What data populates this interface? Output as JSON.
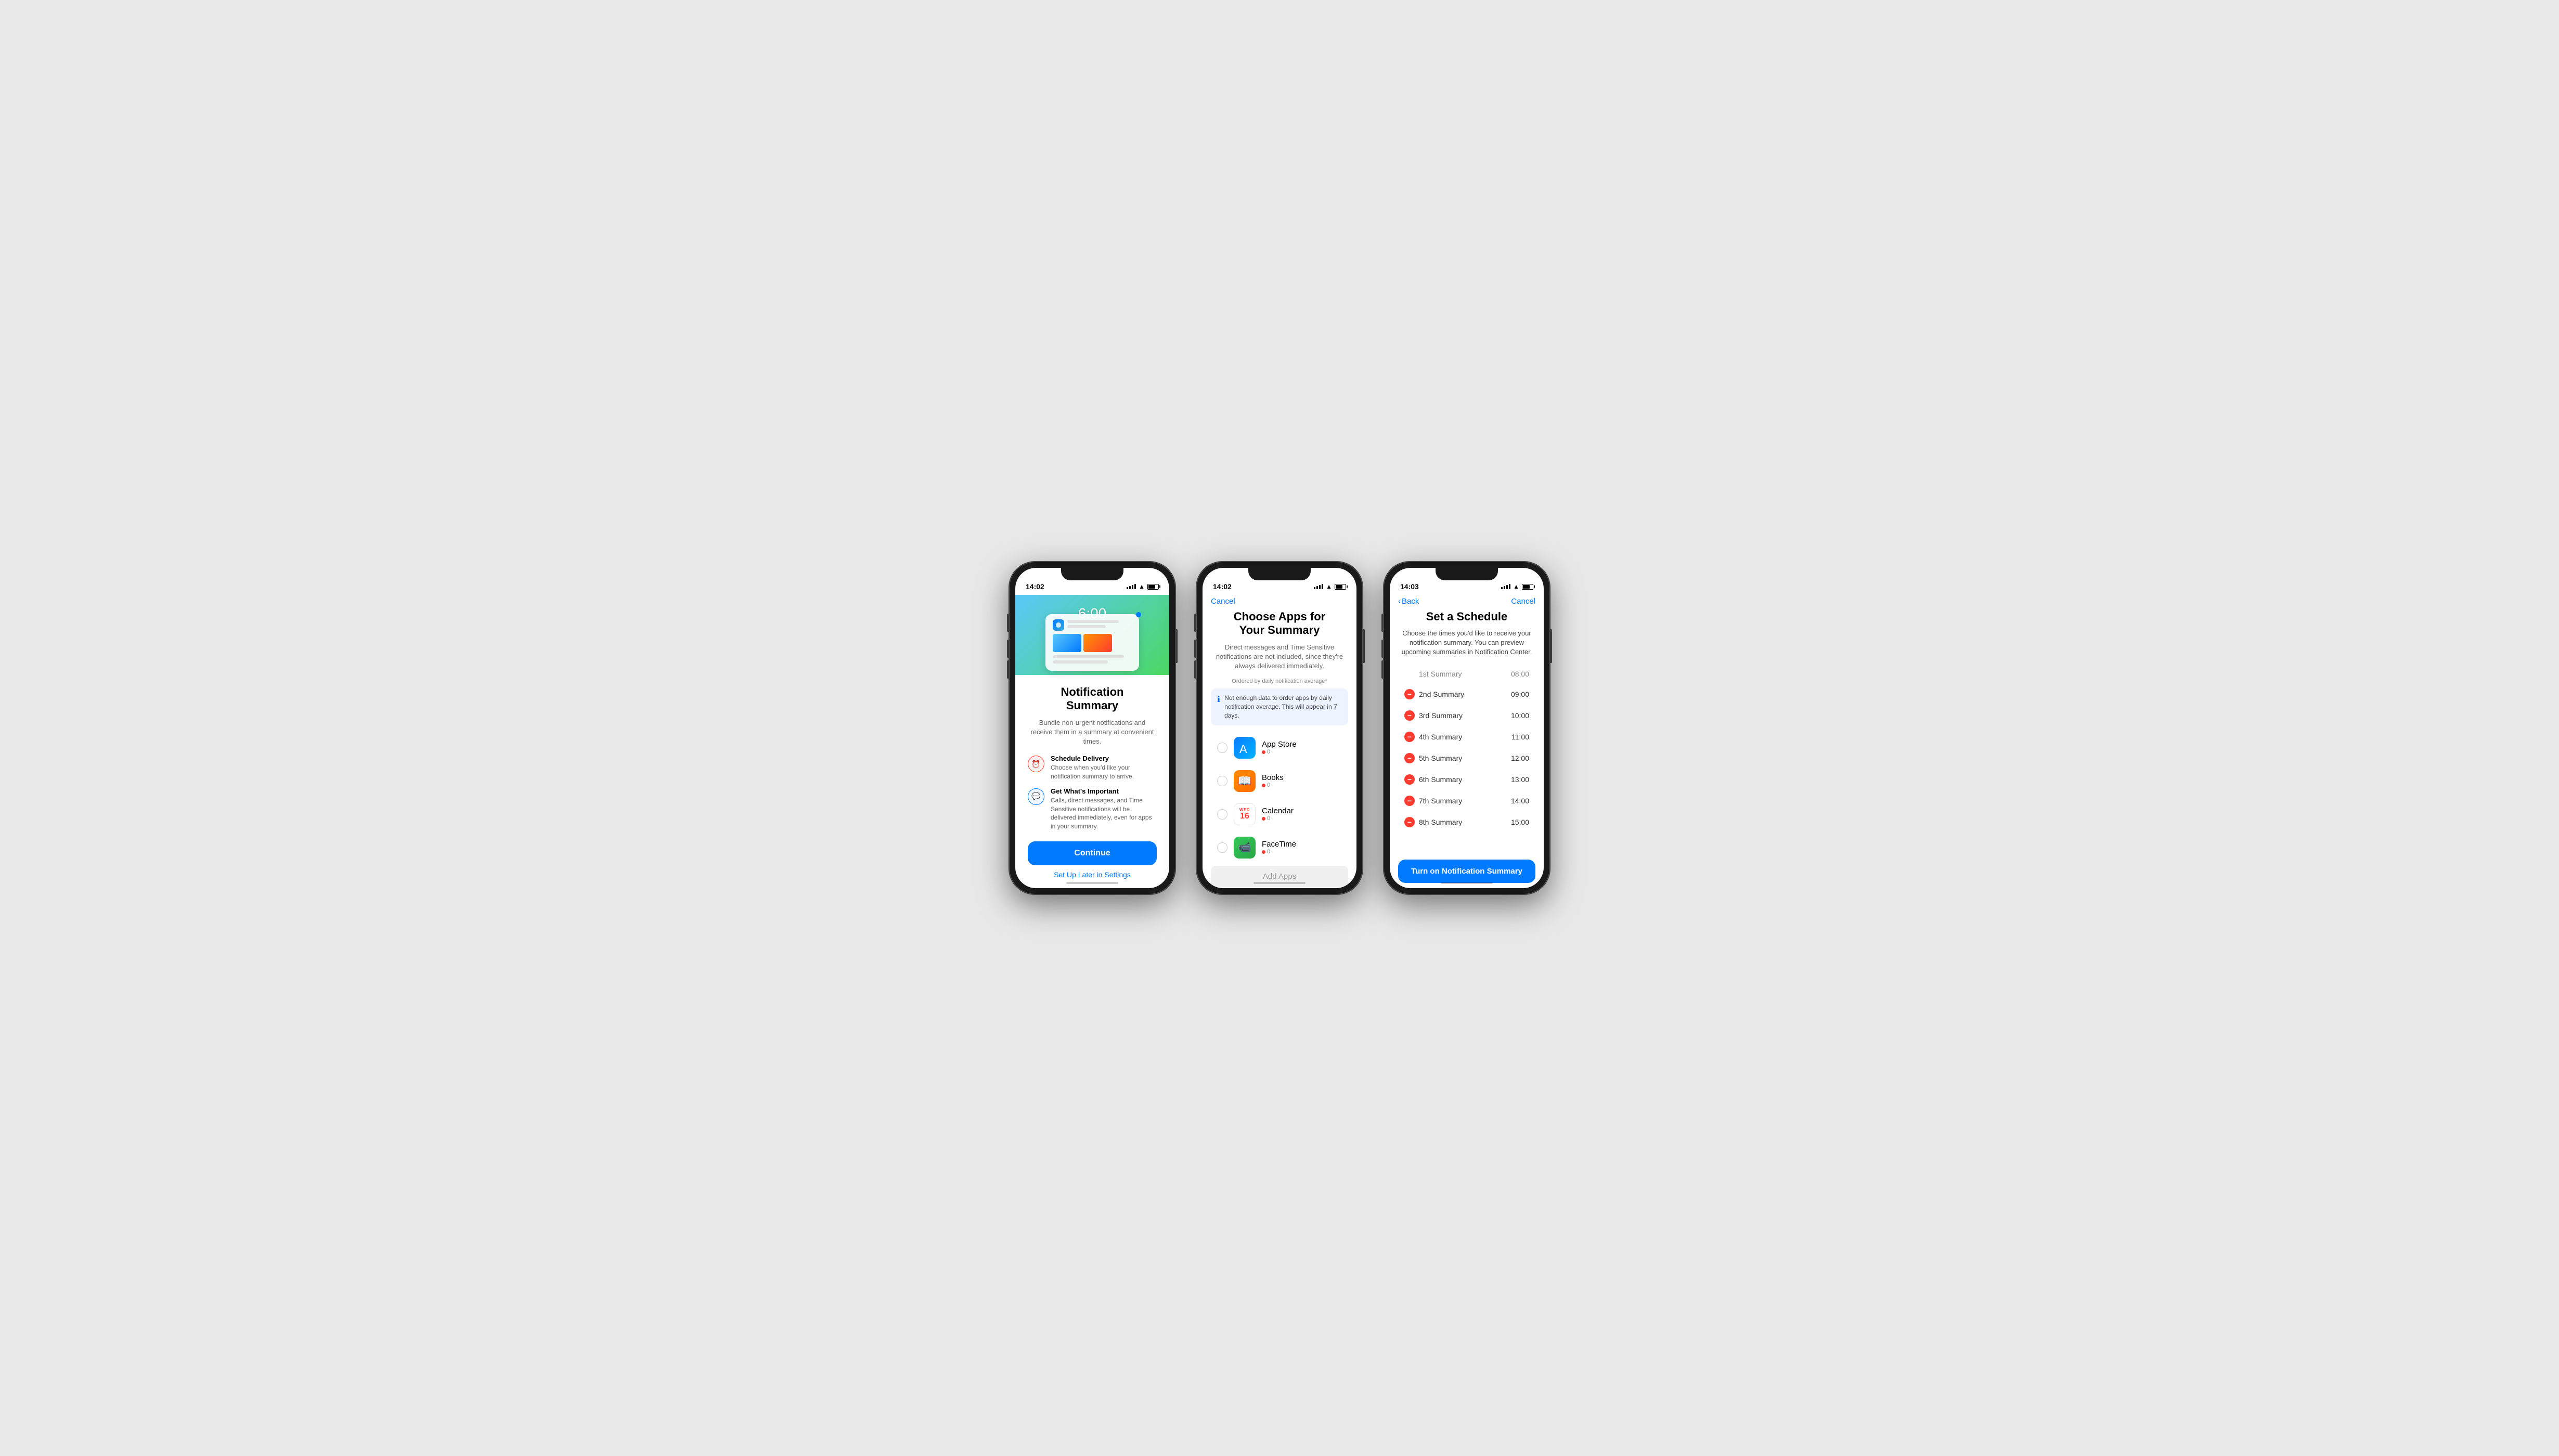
{
  "phone1": {
    "status_time": "14:02",
    "hero_time": "6:00",
    "title": "Notification\nSummary",
    "subtitle": "Bundle non-urgent notifications and receive them in a summary at convenient times.",
    "feature1_title": "Schedule Delivery",
    "feature1_desc": "Choose when you'd like your notification summary to arrive.",
    "feature2_title": "Get What's Important",
    "feature2_desc": "Calls, direct messages, and Time Sensitive notifications will be delivered immediately, even for apps in your summary.",
    "btn_continue": "Continue",
    "btn_later": "Set Up Later in Settings"
  },
  "phone2": {
    "status_time": "14:02",
    "nav_cancel": "Cancel",
    "title": "Choose Apps for\nYour Summary",
    "desc": "Direct messages and Time Sensitive notifications are not included, since they're always delivered immediately.",
    "ordered_label": "Ordered by daily notification average*",
    "info_text": "Not enough data to order apps by daily notification average. This will appear in 7 days.",
    "apps": [
      {
        "name": "App Store",
        "count": "0"
      },
      {
        "name": "Books",
        "count": "0"
      },
      {
        "name": "Calendar",
        "count": "0"
      },
      {
        "name": "FaceTime",
        "count": "0"
      }
    ],
    "add_apps_label": "Add Apps"
  },
  "phone3": {
    "status_time": "14:03",
    "nav_back": "Back",
    "nav_cancel": "Cancel",
    "title": "Set a Schedule",
    "desc": "Choose the times you'd like to receive your notification summary. You can preview upcoming summaries in Notification Center.",
    "summaries": [
      {
        "name": "1st Summary",
        "time": "08:00",
        "removable": false
      },
      {
        "name": "2nd Summary",
        "time": "09:00",
        "removable": true
      },
      {
        "name": "3rd Summary",
        "time": "10:00",
        "removable": true
      },
      {
        "name": "4th Summary",
        "time": "11:00",
        "removable": true
      },
      {
        "name": "5th Summary",
        "time": "12:00",
        "removable": true
      },
      {
        "name": "6th Summary",
        "time": "13:00",
        "removable": true
      },
      {
        "name": "7th Summary",
        "time": "14:00",
        "removable": true
      },
      {
        "name": "8th Summary",
        "time": "15:00",
        "removable": true
      }
    ],
    "btn_label": "Turn on Notification Summary"
  }
}
